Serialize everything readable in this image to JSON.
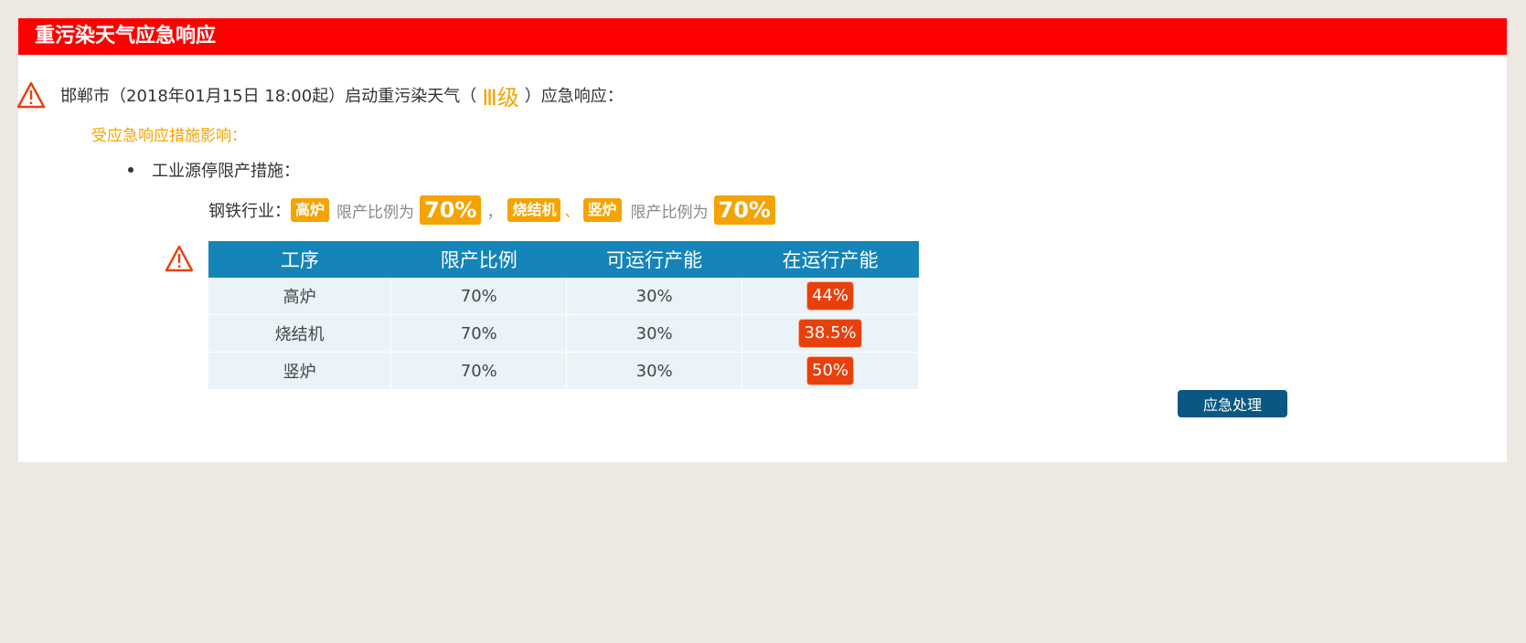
{
  "header": {
    "title": "重污染天气应急响应"
  },
  "alert": {
    "prefix": "邯郸市（2018年01月15日 18:00起）启动重污染天气（",
    "level": "Ⅲ级",
    "suffix": "）应急响应：",
    "icon": "warning-icon"
  },
  "affect_label": "受应急响应措施影响：",
  "measure_label": "工业源停限产措施：",
  "industry": {
    "label": "钢铁行业：",
    "group1_tags": [
      "高炉"
    ],
    "group1_ratio_label": "限产比例为",
    "group1_ratio": "70%",
    "comma": "，",
    "group2_tags": [
      "烧结机",
      "竖炉"
    ],
    "tag_separator": "、",
    "group2_ratio_label": "限产比例为",
    "group2_ratio": "70%"
  },
  "table": {
    "headers": [
      "工序",
      "限产比例",
      "可运行产能",
      "在运行产能"
    ],
    "rows": [
      {
        "process": "高炉",
        "limit": "70%",
        "allowed": "30%",
        "running": "44%"
      },
      {
        "process": "烧结机",
        "limit": "70%",
        "allowed": "30%",
        "running": "38.5%"
      },
      {
        "process": "竖炉",
        "limit": "70%",
        "allowed": "30%",
        "running": "50%"
      }
    ]
  },
  "action_button": "应急处理",
  "colors": {
    "title_bar": "#ff0000",
    "accent": "#f5a300",
    "table_header": "#1584b8",
    "running_badge": "#e8400c",
    "button": "#0a5783"
  }
}
